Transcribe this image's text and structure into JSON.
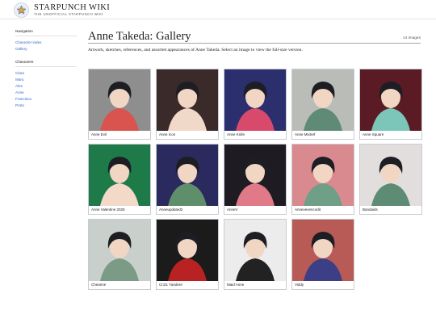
{
  "site": {
    "title": "STARPUNCH WIKI",
    "tagline": "THE UNOFFICIAL STARPUNCH WIKI",
    "logo_icon": "star-logo-icon"
  },
  "sidebar": {
    "navigation": {
      "heading": "Navigation",
      "items": [
        {
          "label": "Character index"
        },
        {
          "label": "Gallery"
        }
      ]
    },
    "characters": {
      "heading": "Characters",
      "items": [
        {
          "label": "Clara"
        },
        {
          "label": "Maru"
        },
        {
          "label": "Alex"
        },
        {
          "label": "Anne"
        },
        {
          "label": "Francisca"
        },
        {
          "label": "Proto"
        }
      ]
    }
  },
  "page": {
    "title": "Anne Takeda: Gallery",
    "count": "14 images",
    "intro": "Artwork, sketches, references, and assorted appearances of Anne Takeda. Select an image to view the full-size version."
  },
  "gallery": [
    {
      "caption": "Anne Evil",
      "bg": "#8e8e8e",
      "accent": "#d9534f"
    },
    {
      "caption": "Anne Icon",
      "bg": "#3a2a2a",
      "accent": "#f0d9c8"
    },
    {
      "caption": "Anne Knife",
      "bg": "#2b2f6e",
      "accent": "#d84a6b"
    },
    {
      "caption": "Anne Mixtref",
      "bg": "#b9bcb7",
      "accent": "#5f8a75"
    },
    {
      "caption": "Anne Square",
      "bg": "#5a1b24",
      "accent": "#7bc6b8"
    },
    {
      "caption": "Anne Valentine 2025",
      "bg": "#1f7a4a",
      "accent": "#f3d9c8"
    },
    {
      "caption": "Anneupdated2",
      "bg": "#2a2a5e",
      "accent": "#5f8f6a"
    },
    {
      "caption": "AnneV",
      "bg": "#1e1c22",
      "accent": "#e07a88"
    },
    {
      "caption": "Annevevencodit",
      "bg": "#d98a8e",
      "accent": "#6f9f86"
    },
    {
      "caption": "Bandaids",
      "bg": "#e3dede",
      "accent": "#5e8b74"
    },
    {
      "caption": "Cheanne",
      "bg": "#c9d0cc",
      "accent": "#7c9b86"
    },
    {
      "caption": "Cr1t1 Yandere",
      "bg": "#1b1b1b",
      "accent": "#b82222"
    },
    {
      "caption": "Maid Anne",
      "bg": "#ececec",
      "accent": "#222222"
    },
    {
      "caption": "Viddy",
      "bg": "#b85a55",
      "accent": "#3d3f86"
    }
  ]
}
